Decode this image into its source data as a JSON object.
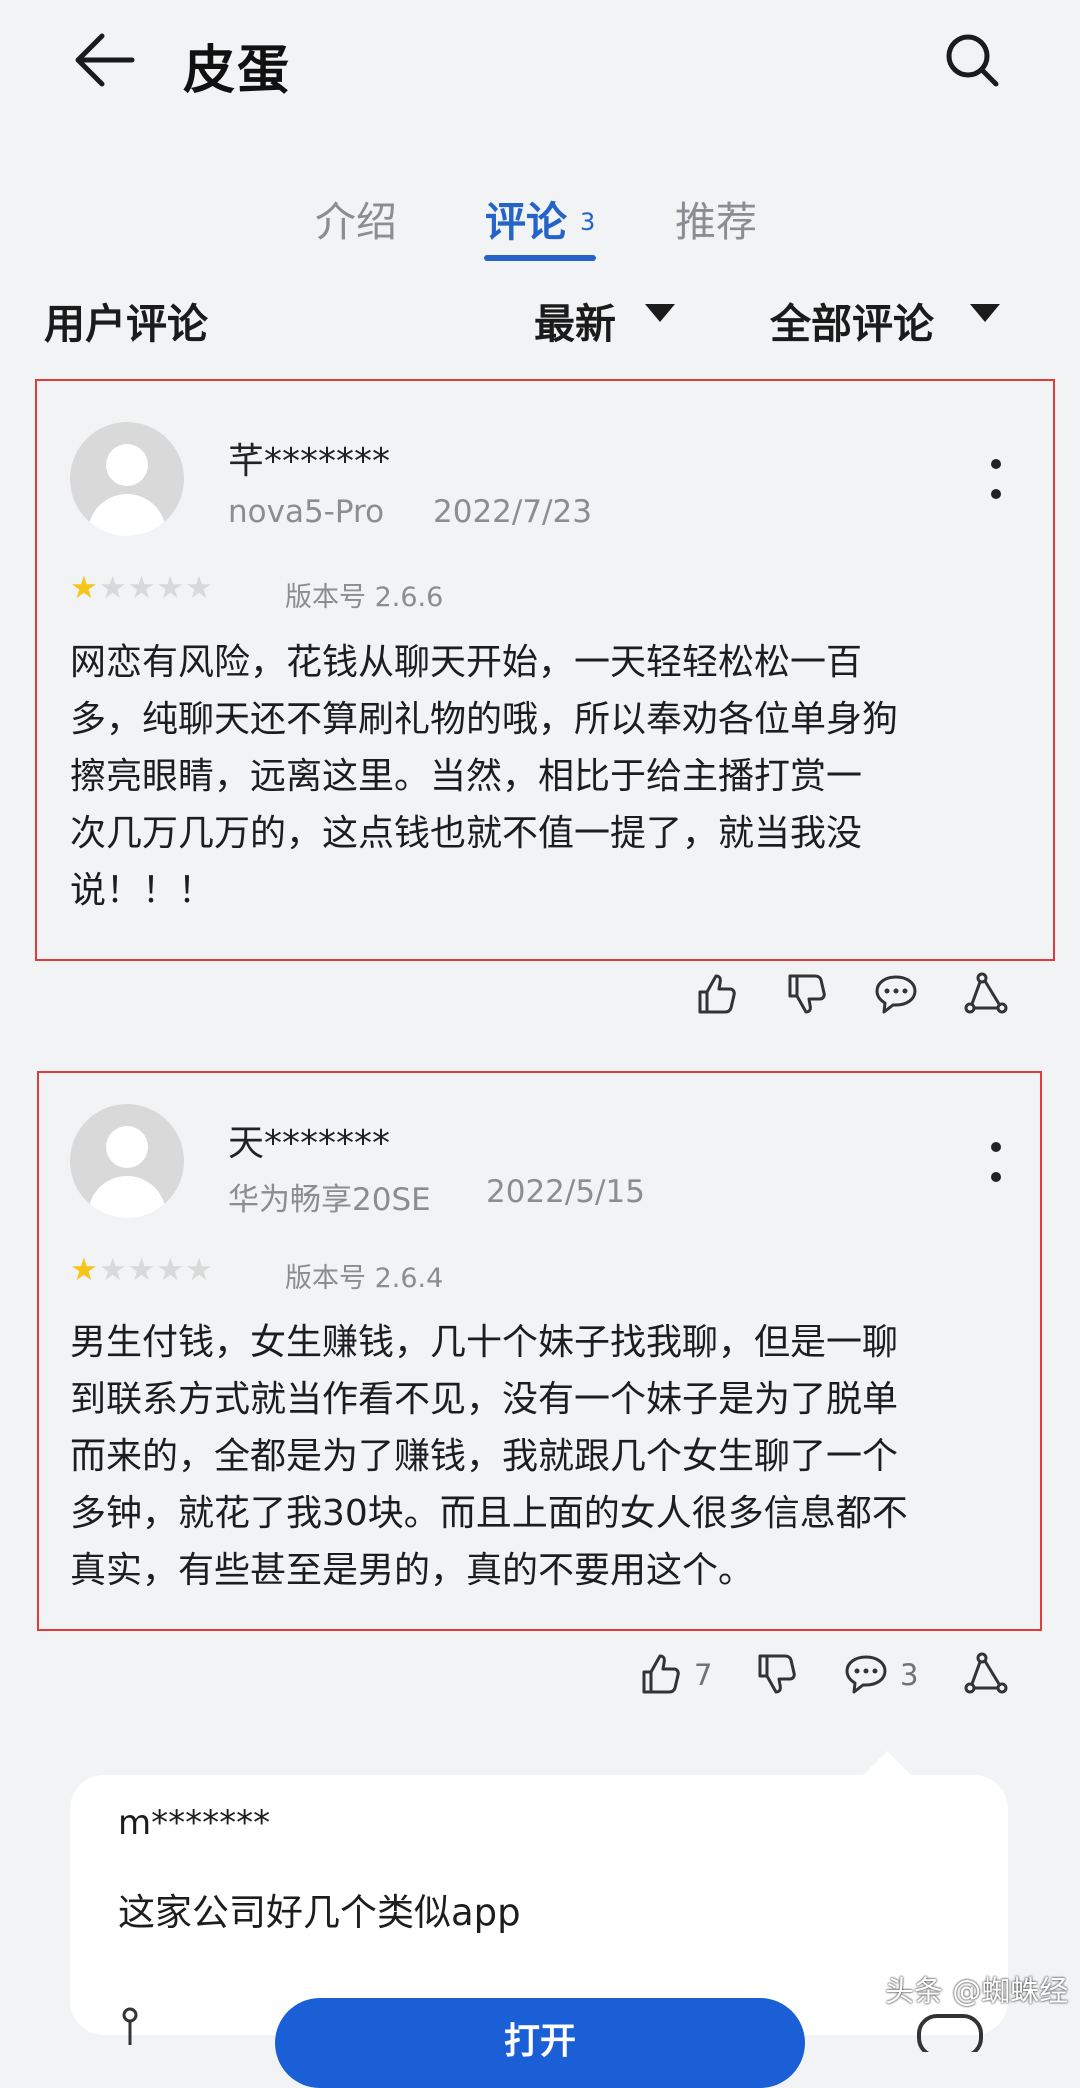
{
  "header": {
    "title": "皮蛋"
  },
  "tabs": [
    {
      "label": "介绍"
    },
    {
      "label": "评论",
      "count": "3"
    },
    {
      "label": "推荐"
    }
  ],
  "filters": {
    "section_title": "用户评论",
    "sort": "最新",
    "scope": "全部评论"
  },
  "reviews": [
    {
      "username": "芊*******",
      "device": "nova5-Pro",
      "date": "2022/7/23",
      "rating": 1,
      "version": "版本号 2.6.6",
      "lines": [
        "网恋有风险，花钱从聊天开始，一天轻轻松松一百",
        "多，纯聊天还不算刷礼物的哦，所以奉劝各位单身狗",
        "擦亮眼睛，远离这里。当然，相比于给主播打赏一",
        "次几万几万的，这点钱也就不值一提了，就当我没",
        "说！！！"
      ]
    },
    {
      "username": "天*******",
      "device": "华为畅享20SE",
      "date": "2022/5/15",
      "rating": 1,
      "version": "版本号 2.6.4",
      "lines": [
        "男生付钱，女生赚钱，几十个妹子找我聊，但是一聊",
        "到联系方式就当作看不见，没有一个妹子是为了脱单",
        "而来的，全都是为了赚钱，我就跟几个女生聊了一个",
        "多钟，就花了我30块。而且上面的女人很多信息都不",
        "真实，有些甚至是男的，真的不要用这个。"
      ],
      "likes": "7",
      "comments": "3"
    }
  ],
  "reply": {
    "username": "m*******",
    "text": "这家公司好几个类似app"
  },
  "bottom": {
    "button_label": "打开"
  },
  "watermark": "头条 @蜘蛛经",
  "colors": {
    "accent": "#2563c9",
    "highlight_border": "#e23b3b",
    "star": "#f5c518"
  },
  "icons": [
    "back-arrow",
    "search",
    "thumb-up",
    "thumb-down",
    "comment-bubble",
    "share",
    "more-vertical"
  ]
}
